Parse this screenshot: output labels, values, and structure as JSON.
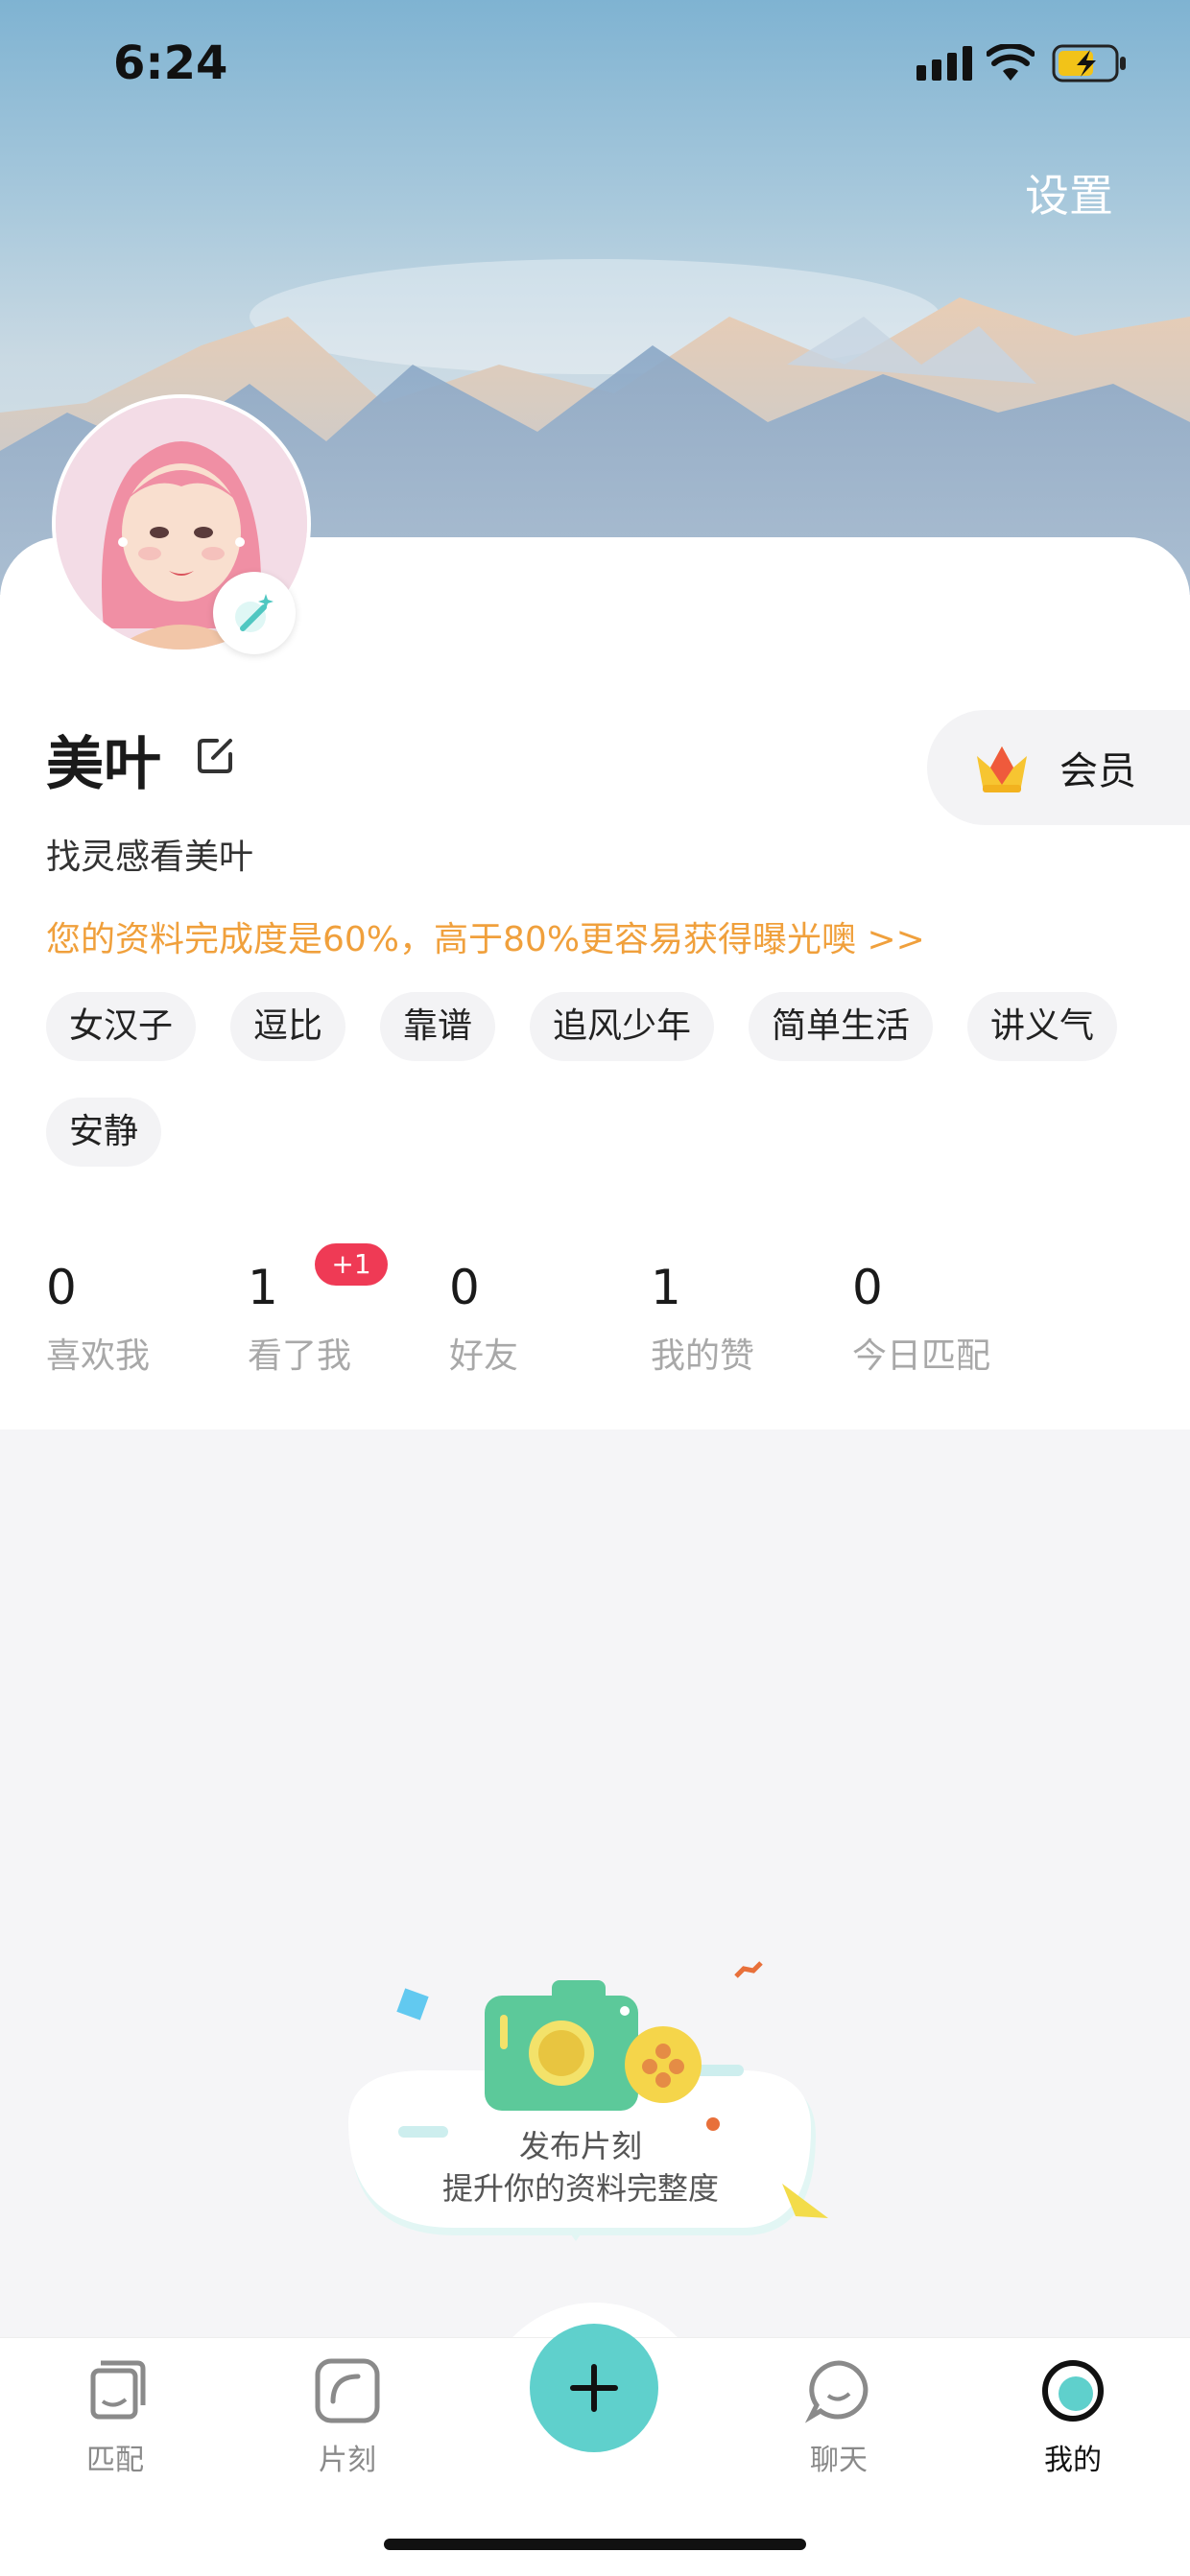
{
  "status_bar": {
    "time": "6:24"
  },
  "header": {
    "settings_label": "设置"
  },
  "profile": {
    "name": "美叶",
    "bio": "找灵感看美叶",
    "completion_text": "您的资料完成度是60%，高于80%更容易获得曝光噢 >>",
    "vip_label": "会员",
    "tags": [
      "女汉子",
      "逗比",
      "靠谱",
      "追风少年",
      "简单生活",
      "讲义气",
      "安静"
    ]
  },
  "stats": [
    {
      "value": "0",
      "label": "喜欢我"
    },
    {
      "value": "1",
      "label": "看了我",
      "badge": "+1"
    },
    {
      "value": "0",
      "label": "好友"
    },
    {
      "value": "1",
      "label": "我的赞"
    },
    {
      "value": "0",
      "label": "今日匹配"
    }
  ],
  "empty_state": {
    "title": "发布片刻",
    "subtitle": "提升你的资料完整度"
  },
  "tabbar": {
    "items": [
      {
        "label": "匹配",
        "icon": "cards-icon"
      },
      {
        "label": "片刻",
        "icon": "moment-icon"
      },
      {
        "label": "",
        "icon": "plus-icon"
      },
      {
        "label": "聊天",
        "icon": "chat-bubble-icon"
      },
      {
        "label": "我的",
        "icon": "profile-circle-icon"
      }
    ],
    "active_index": 4
  },
  "colors": {
    "accent_teal": "#5fd0cc",
    "completion_orange": "#f0a03c",
    "badge_red": "#ef3a55"
  }
}
